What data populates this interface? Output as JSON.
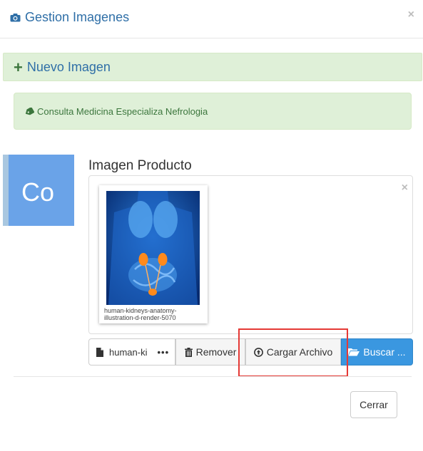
{
  "header": {
    "title": "Gestion Imagenes",
    "icon": "camera-icon",
    "close_glyph": "×"
  },
  "panel_new": {
    "label": "Nuevo Imagen",
    "icon": "plus-icon"
  },
  "alert": {
    "text": "Consulta Medicina Especializa Nefrologia",
    "icon": "tag-icon"
  },
  "avatar": {
    "initials": "Co",
    "color": "#6aa3e8"
  },
  "image_section": {
    "label": "Imagen Producto",
    "remove_glyph": "×",
    "thumbnail_caption": "human-kidneys-anatomy-illustration-d-render-5070"
  },
  "file_input": {
    "caption": "human-ki",
    "ellipsis": "•••",
    "remove_label": "Remover",
    "upload_label": "Cargar Archivo",
    "browse_label": "Buscar ..."
  },
  "footer": {
    "close_label": "Cerrar"
  },
  "colors": {
    "accent": "#2f6fa7",
    "success_bg": "#dff0d8",
    "primary": "#3a97e0",
    "highlight": "#e53935"
  }
}
